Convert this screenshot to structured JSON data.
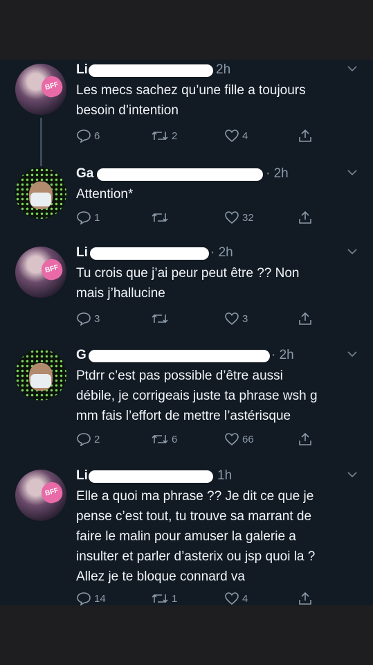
{
  "tweets": [
    {
      "name": "Li",
      "time": "2h",
      "lines": [
        "Les mecs sachez qu’une fille a toujours",
        "besoin d’intention"
      ],
      "replies": "6",
      "retweets": "2",
      "likes": "4"
    },
    {
      "name": "Ga",
      "time": "· 2h",
      "lines": [
        "Attention*"
      ],
      "replies": "1",
      "retweets": "",
      "likes": "32"
    },
    {
      "name": "Li",
      "time": "· 2h",
      "lines": [
        "Tu crois que j’ai peur peut être ?? Non",
        "mais j’hallucine"
      ],
      "replies": "3",
      "retweets": "",
      "likes": "3"
    },
    {
      "name": "G",
      "time": "· 2h",
      "lines": [
        "Ptdrr c’est pas possible d’être aussi",
        "débile, je corrigeais juste ta phrase wsh g",
        "mm fais l’effort de mettre l’astérisque"
      ],
      "replies": "2",
      "retweets": "6",
      "likes": "66"
    },
    {
      "name": "Li",
      "time": "1h",
      "lines": [
        "Elle a quoi ma phrase ?? Je dit ce que je",
        "pense c’est tout, tu trouve sa marrant de",
        "faire le malin pour amuser la galerie a",
        "insulter et parler d’asterix ou jsp quoi la ?",
        "Allez je te bloque connard va"
      ],
      "replies": "14",
      "retweets": "1",
      "likes": "4"
    }
  ],
  "avatar_badge": "BFF",
  "colors": {
    "background": "#121a24",
    "text": "#f2f5f8",
    "muted": "#8a9aa8",
    "thread_line": "#3a4b5c"
  }
}
